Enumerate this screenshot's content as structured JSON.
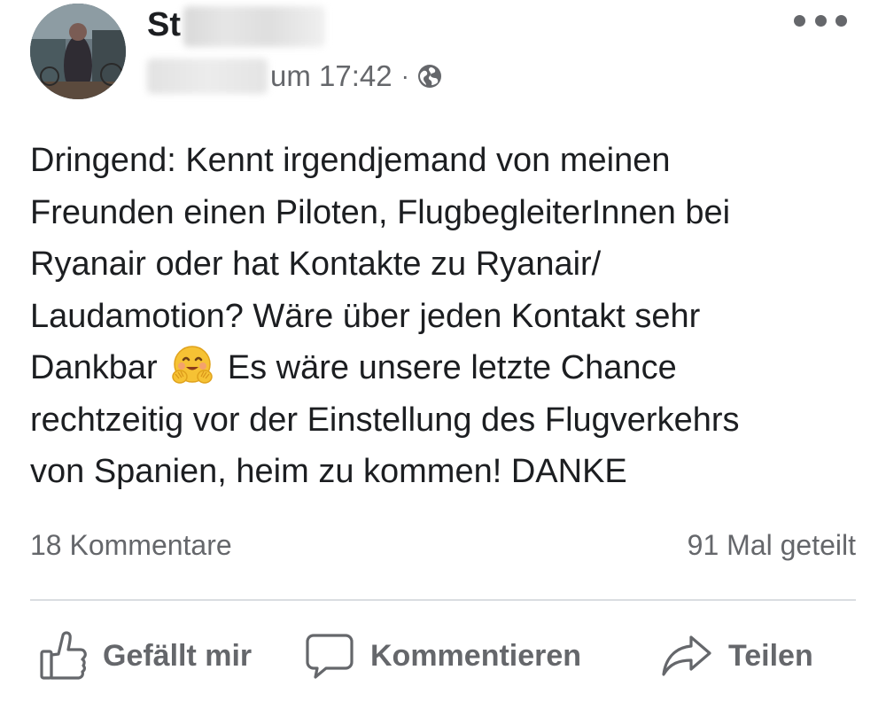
{
  "post": {
    "author_name": "St",
    "time": "um 17:42",
    "separator": "·",
    "privacy_icon": "globe-icon",
    "text_lines": [
      "Dringend: Kennt irgendjemand von meinen",
      "Freunden einen Piloten, FlugbegleiterInnen bei",
      "Ryanair oder hat Kontakte zu Ryanair/",
      "Laudamotion? Wäre über jeden Kontakt sehr",
      "Dankbar",
      "Es wäre unsere letzte Chance",
      "rechtzeitig vor der Einstellung des Flugverkehrs",
      "von Spanien, heim zu kommen! DANKE"
    ],
    "emoji": "hugging-face-emoji"
  },
  "stats": {
    "comments": "18 Kommentare",
    "shares": "91 Mal geteilt"
  },
  "actions": {
    "like": "Gefällt mir",
    "comment": "Kommentieren",
    "share": "Teilen"
  },
  "colors": {
    "text_primary": "#1c1e21",
    "text_secondary": "#65676b",
    "divider": "#dadde1",
    "background": "#ffffff"
  }
}
